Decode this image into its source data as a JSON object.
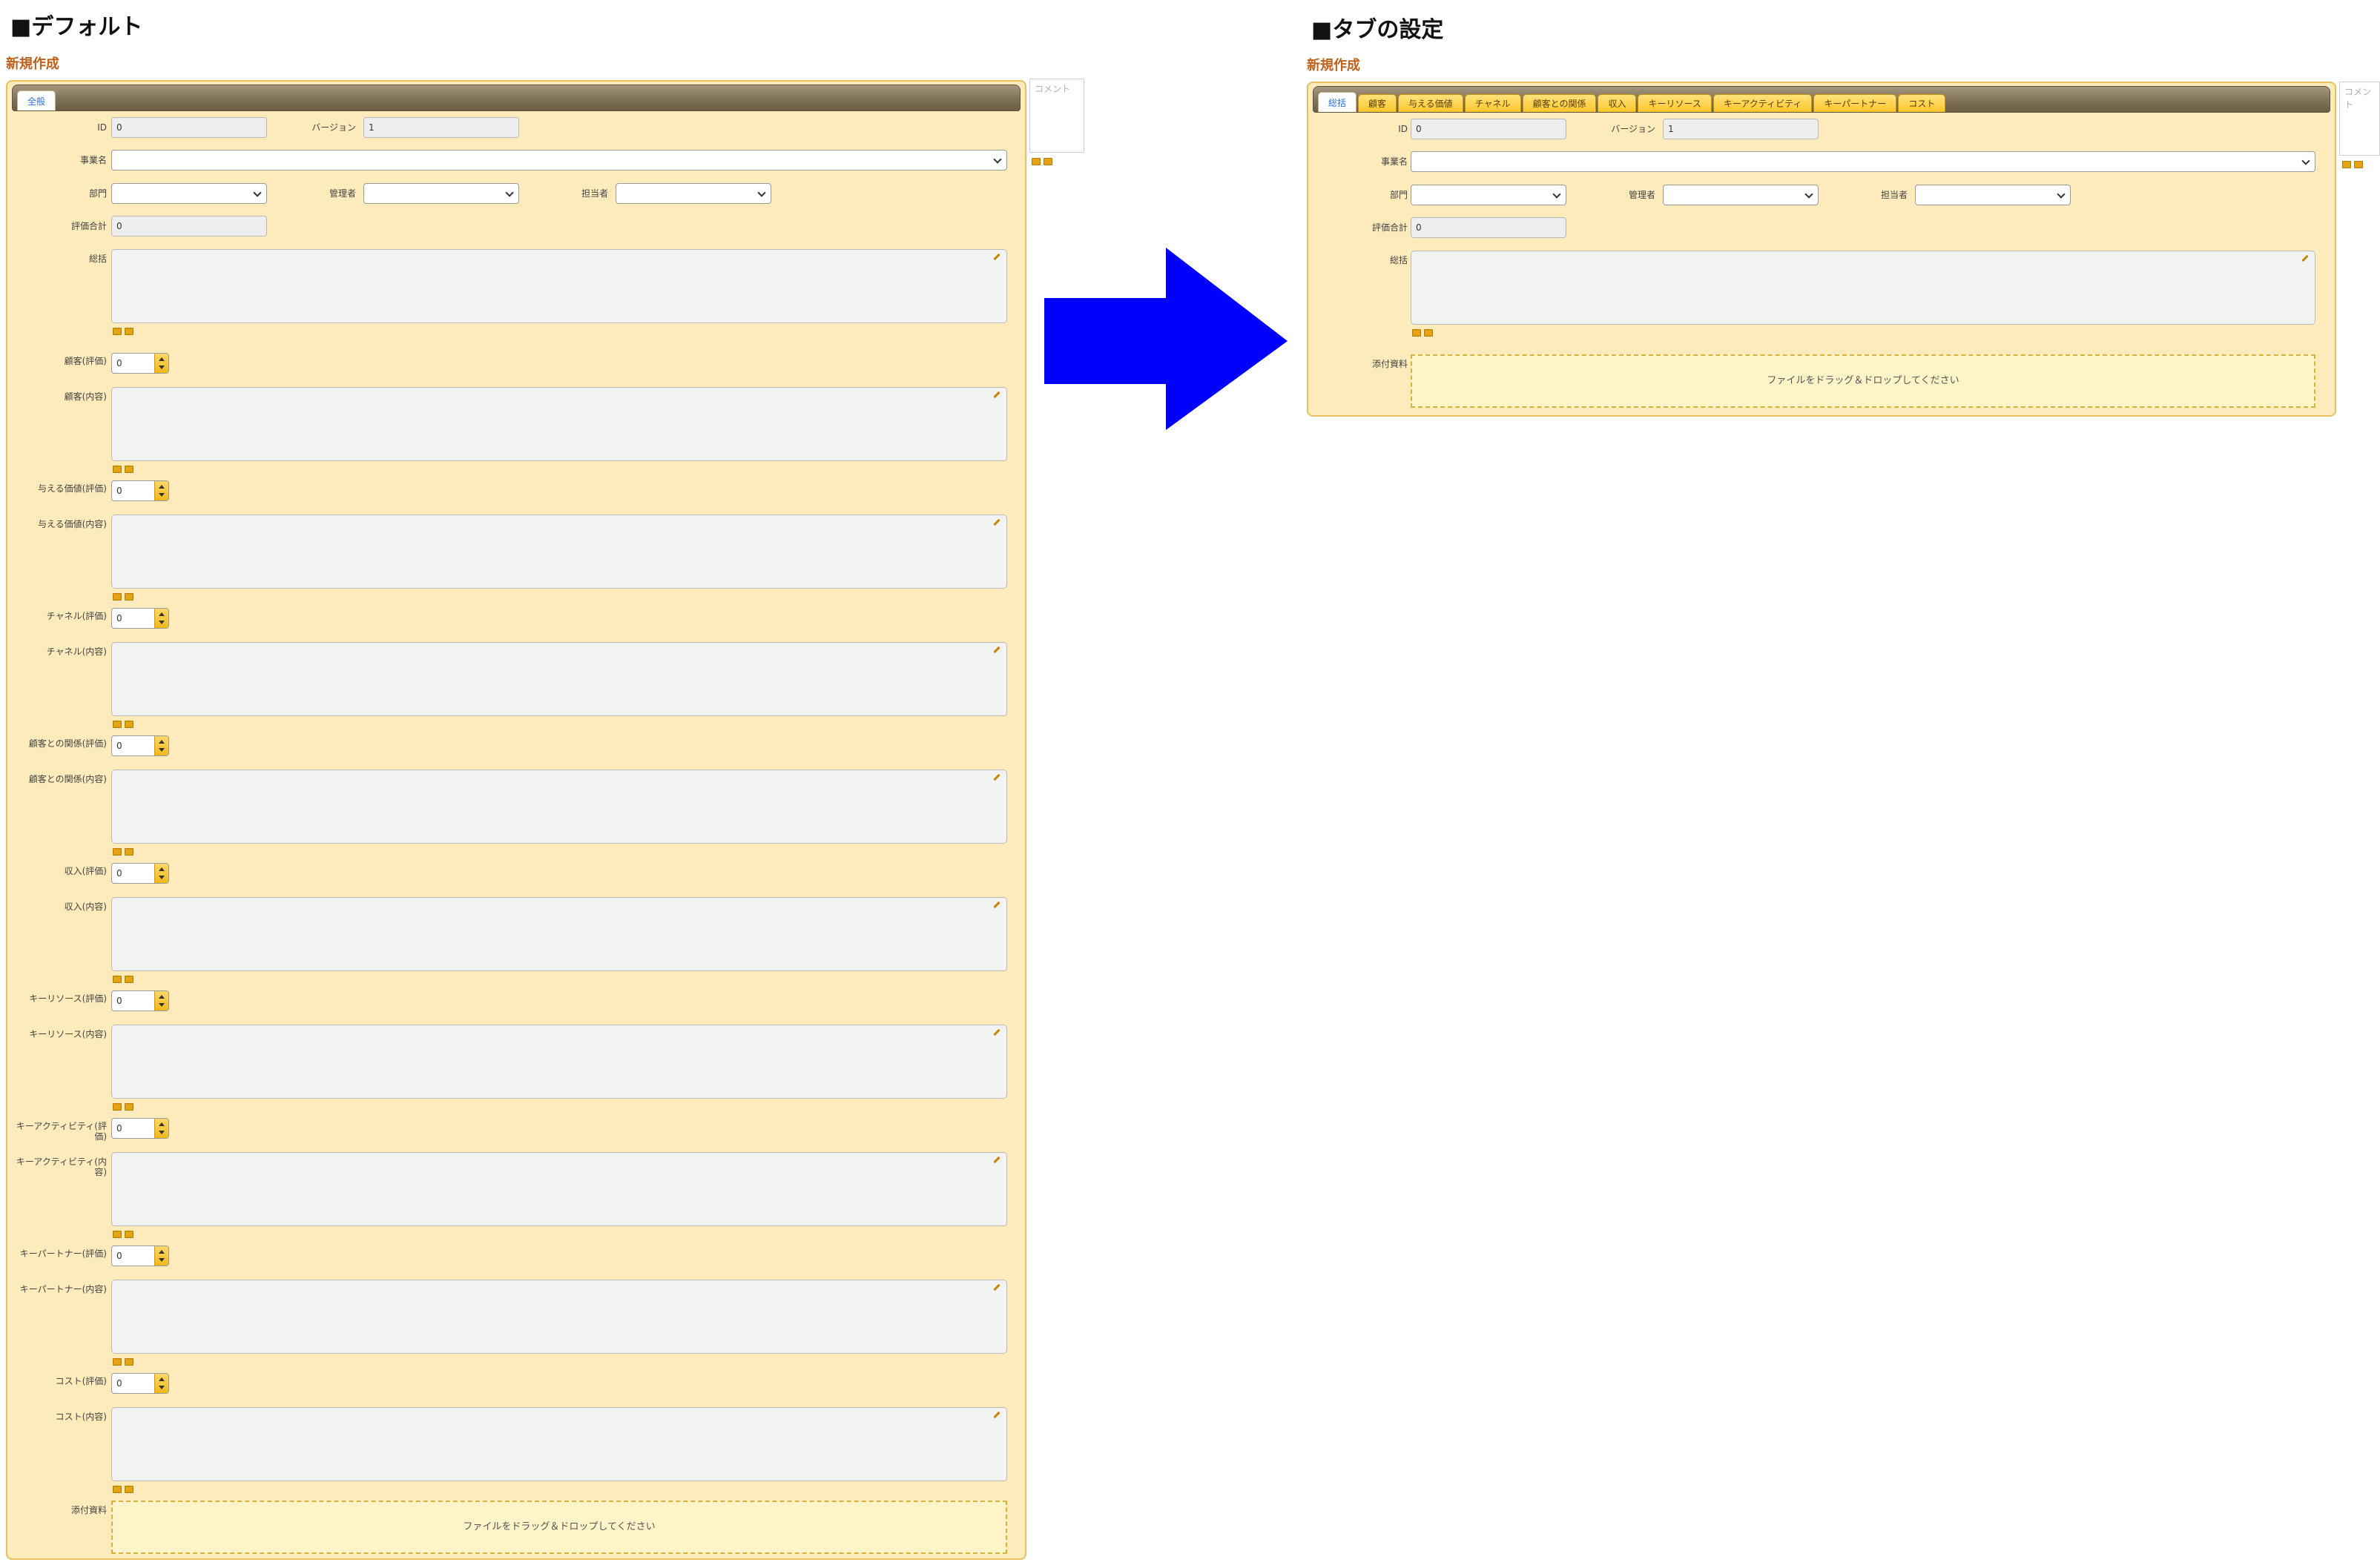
{
  "left": {
    "heading": "■デフォルト",
    "new_label": "新規作成",
    "tabs": [
      {
        "label": "全般",
        "active": true
      }
    ],
    "comment_placeholder": "コメント",
    "fields": [
      {
        "id": "id",
        "label": "ID",
        "type": "text",
        "value": "0"
      },
      {
        "id": "version",
        "label": "バージョン",
        "type": "text",
        "value": "1"
      },
      {
        "id": "jigyo",
        "label": "事業名",
        "type": "select",
        "value": ""
      },
      {
        "id": "bumon",
        "label": "部門",
        "type": "select",
        "value": ""
      },
      {
        "id": "kanri",
        "label": "管理者",
        "type": "select",
        "value": ""
      },
      {
        "id": "tanto",
        "label": "担当者",
        "type": "select",
        "value": ""
      },
      {
        "id": "hyoka-total",
        "label": "評価合計",
        "type": "text",
        "value": "0"
      },
      {
        "id": "sokatsu",
        "label": "総括",
        "type": "textarea",
        "value": ""
      },
      {
        "id": "kokyaku-h",
        "label": "顧客(評価)",
        "type": "number",
        "value": "0"
      },
      {
        "id": "kokyaku-n",
        "label": "顧客(内容)",
        "type": "textarea",
        "value": ""
      },
      {
        "id": "kachi-h",
        "label": "与える価値(評価)",
        "type": "number",
        "value": "0"
      },
      {
        "id": "kachi-n",
        "label": "与える価値(内容)",
        "type": "textarea",
        "value": ""
      },
      {
        "id": "channel-h",
        "label": "チャネル(評価)",
        "type": "number",
        "value": "0"
      },
      {
        "id": "channel-n",
        "label": "チャネル(内容)",
        "type": "textarea",
        "value": ""
      },
      {
        "id": "kankei-h",
        "label": "顧客との関係(評価)",
        "type": "number",
        "value": "0"
      },
      {
        "id": "kankei-n",
        "label": "顧客との関係(内容)",
        "type": "textarea",
        "value": ""
      },
      {
        "id": "shunyu-h",
        "label": "収入(評価)",
        "type": "number",
        "value": "0"
      },
      {
        "id": "shunyu-n",
        "label": "収入(内容)",
        "type": "textarea",
        "value": ""
      },
      {
        "id": "resource-h",
        "label": "キーリソース(評価)",
        "type": "number",
        "value": "0"
      },
      {
        "id": "resource-n",
        "label": "キーリソース(内容)",
        "type": "textarea",
        "value": ""
      },
      {
        "id": "activity-h",
        "label": "キーアクティビティ(評価)",
        "type": "number",
        "value": "0"
      },
      {
        "id": "activity-n",
        "label": "キーアクティビティ(内容)",
        "type": "textarea",
        "value": ""
      },
      {
        "id": "partner-h",
        "label": "キーパートナー(評価)",
        "type": "number",
        "value": "0"
      },
      {
        "id": "partner-n",
        "label": "キーパートナー(内容)",
        "type": "textarea",
        "value": ""
      },
      {
        "id": "cost-h",
        "label": "コスト(評価)",
        "type": "number",
        "value": "0"
      },
      {
        "id": "cost-n",
        "label": "コスト(内容)",
        "type": "textarea",
        "value": ""
      },
      {
        "id": "attach",
        "label": "添付資料",
        "type": "dropzone",
        "value": "ファイルをドラッグ＆ドロップしてください"
      }
    ]
  },
  "right": {
    "heading": "■タブの設定",
    "new_label": "新規作成",
    "comment_placeholder": "コメント",
    "tabs": [
      {
        "label": "総括",
        "active": true
      },
      {
        "label": "顧客",
        "active": false
      },
      {
        "label": "与える価値",
        "active": false
      },
      {
        "label": "チャネル",
        "active": false
      },
      {
        "label": "顧客との関係",
        "active": false
      },
      {
        "label": "収入",
        "active": false
      },
      {
        "label": "キーリソース",
        "active": false
      },
      {
        "label": "キーアクティビティ",
        "active": false
      },
      {
        "label": "キーパートナー",
        "active": false
      },
      {
        "label": "コスト",
        "active": false
      }
    ],
    "fields": [
      {
        "id": "id",
        "label": "ID",
        "type": "text",
        "value": "0"
      },
      {
        "id": "version",
        "label": "バージョン",
        "type": "text",
        "value": "1"
      },
      {
        "id": "jigyo",
        "label": "事業名",
        "type": "select",
        "value": ""
      },
      {
        "id": "bumon",
        "label": "部門",
        "type": "select",
        "value": ""
      },
      {
        "id": "kanri",
        "label": "管理者",
        "type": "select",
        "value": ""
      },
      {
        "id": "tanto",
        "label": "担当者",
        "type": "select",
        "value": ""
      },
      {
        "id": "hyoka-total",
        "label": "評価合計",
        "type": "text",
        "value": "0"
      },
      {
        "id": "sokatsu",
        "label": "総括",
        "type": "textarea",
        "value": ""
      },
      {
        "id": "attach",
        "label": "添付資料",
        "type": "dropzone",
        "value": "ファイルをドラッグ＆ドロップしてください"
      }
    ]
  },
  "colors": {
    "arrow": "#0000ff",
    "accent": "#c0601a",
    "panel": "#fdebbb"
  }
}
